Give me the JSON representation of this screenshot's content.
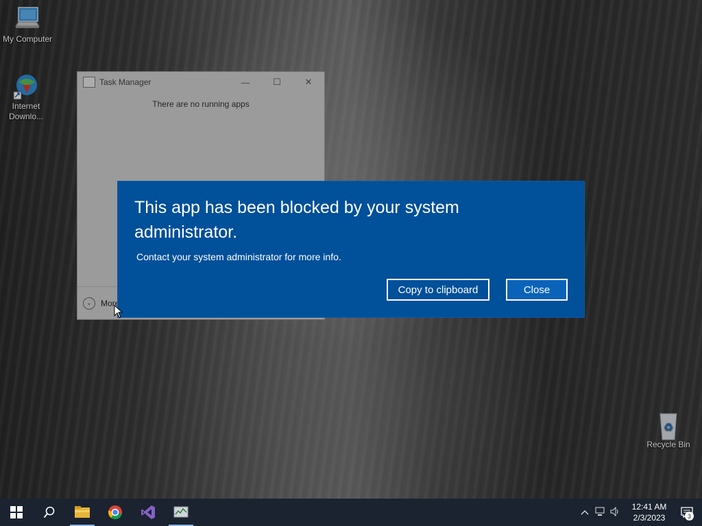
{
  "desktop": {
    "icons": [
      {
        "label": "My Computer"
      },
      {
        "label": "Internet Downlo..."
      },
      {
        "label": "Recycle Bin"
      }
    ]
  },
  "task_manager": {
    "title": "Task Manager",
    "message": "There are no running apps",
    "more_details_visible": "More",
    "controls": {
      "minimize": "—",
      "maximize": "☐",
      "close": "✕"
    }
  },
  "blocked_dialog": {
    "title": "This app has been blocked by your system administrator.",
    "subtitle": "Contact your system administrator for more info.",
    "copy_button": "Copy to clipboard",
    "close_button": "Close",
    "background_color": "#00509a"
  },
  "taskbar": {
    "apps": [
      {
        "icon": "windows-start-icon"
      },
      {
        "icon": "search-icon"
      },
      {
        "icon": "file-explorer-icon"
      },
      {
        "icon": "chrome-icon"
      },
      {
        "icon": "visual-studio-icon"
      },
      {
        "icon": "task-manager-icon"
      }
    ],
    "clock": {
      "time": "12:41 AM",
      "date": "2/3/2023"
    },
    "notifications_count": "3"
  }
}
